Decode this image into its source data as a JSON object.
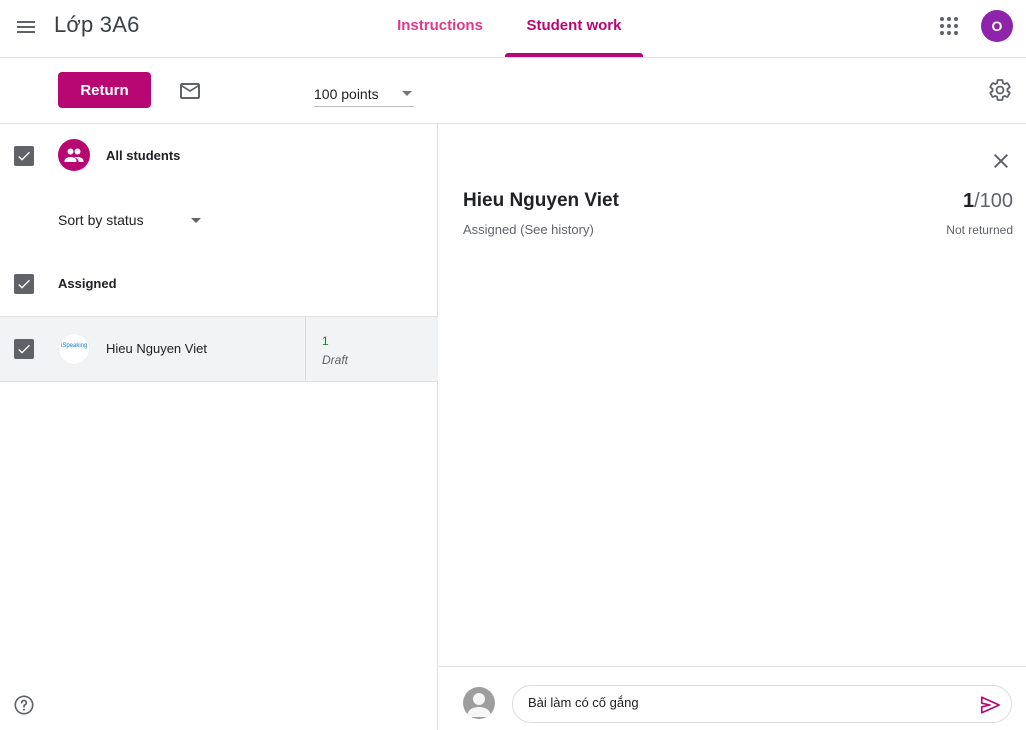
{
  "header": {
    "class_title": "Lớp 3A6",
    "tabs": [
      {
        "label": "Instructions"
      },
      {
        "label": "Student work"
      }
    ],
    "active_tab": "Student work",
    "user_initial": "O",
    "colors": {
      "accent": "#b80672",
      "avatar": "#8e24aa"
    }
  },
  "toolbar": {
    "return_label": "Return",
    "points_value": "100 points"
  },
  "roster": {
    "all_students_label": "All students",
    "sort_label": "Sort by status",
    "section_label": "Assigned",
    "students": [
      {
        "name": "Hieu Nguyen Viet",
        "avatar_text": "iSpeaking",
        "grade": "1",
        "grade_status": "Draft"
      }
    ]
  },
  "detail": {
    "student_name": "Hieu Nguyen Viet",
    "status": "Assigned",
    "history_link": "(See history)",
    "score": "1",
    "score_total": "100",
    "return_status": "Not returned"
  },
  "comment": {
    "value": "Bài làm có cố gắng"
  }
}
